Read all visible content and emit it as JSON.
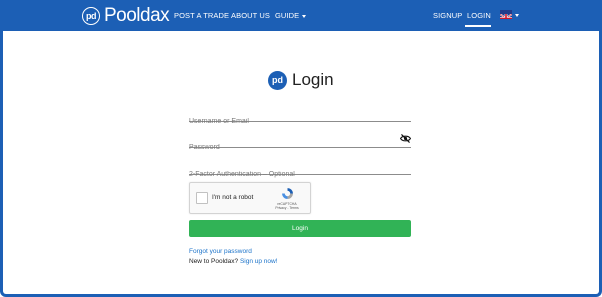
{
  "navbar": {
    "brand_mark": "pd",
    "brand_name": "Pooldax",
    "items": [
      {
        "label": "POST A TRADE"
      },
      {
        "label": "ABOUT US"
      },
      {
        "label": "GUIDE"
      }
    ],
    "signup_label": "SIGNUP",
    "login_label": "LOGIN",
    "language_icon": "uk-flag-icon",
    "color": "#1c5fb5"
  },
  "login": {
    "logo_mark": "pd",
    "title": "Login",
    "username_placeholder": "Username or Email",
    "password_placeholder": "Password",
    "twofa_placeholder": "2-Factor Authentication – Optional",
    "captcha_label": "I'm not a robot",
    "captcha_brand": "reCAPTCHA",
    "captcha_links": "Privacy - Terms",
    "submit_label": "Login",
    "submit_color": "#31b356",
    "forgot_label": "Forgot your password",
    "new_user_text": "New to Pooldax?",
    "signup_link_label": "Sign up now!"
  }
}
